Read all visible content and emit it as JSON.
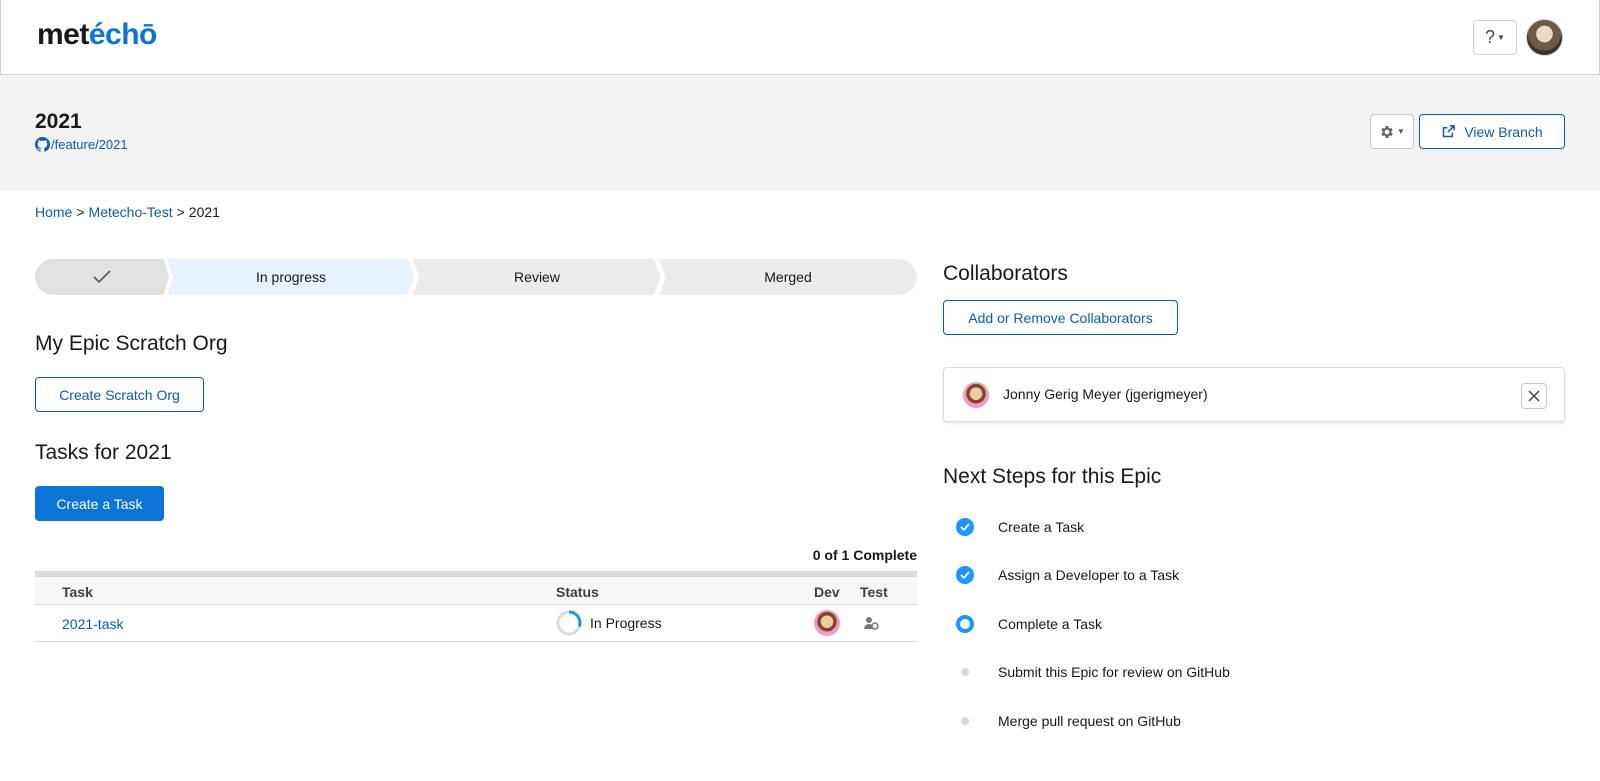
{
  "app": {
    "logo_main": "met",
    "logo_accent": "échō",
    "help_label": "?"
  },
  "epic": {
    "title": "2021",
    "branch": "/feature/2021",
    "view_branch_label": "View Branch"
  },
  "breadcrumb": {
    "home": "Home",
    "project": "Metecho-Test",
    "current": "2021",
    "separator": ">"
  },
  "path": {
    "steps": [
      "",
      "In progress",
      "Review",
      "Merged"
    ],
    "completed_step_icon": "checkmark-icon"
  },
  "scratch_org": {
    "heading": "My Epic Scratch Org",
    "create_label": "Create Scratch Org"
  },
  "tasks": {
    "heading": "Tasks for 2021",
    "create_label": "Create a Task",
    "complete_count": "0 of 1 Complete",
    "columns": {
      "task": "Task",
      "status": "Status",
      "dev": "Dev",
      "test": "Test"
    },
    "rows": [
      {
        "name": "2021-task",
        "status": "In Progress",
        "progress": 0.3
      }
    ]
  },
  "collaborators": {
    "heading": "Collaborators",
    "manage_label": "Add or Remove Collaborators",
    "list": [
      {
        "name": "Jonny Gerig Meyer (jgerigmeyer)"
      }
    ]
  },
  "next_steps": {
    "heading": "Next Steps for this Epic",
    "items": [
      {
        "label": "Create a Task",
        "state": "done"
      },
      {
        "label": "Assign a Developer to a Task",
        "state": "done"
      },
      {
        "label": "Complete a Task",
        "state": "current"
      },
      {
        "label": "Submit this Epic for review on GitHub",
        "state": "todo"
      },
      {
        "label": "Merge pull request on GitHub",
        "state": "todo"
      }
    ]
  },
  "colors": {
    "brand": "#0b74d6",
    "link": "#0b5cab",
    "step_done": "#1b96ff",
    "path_active": "#e8f2fe"
  }
}
